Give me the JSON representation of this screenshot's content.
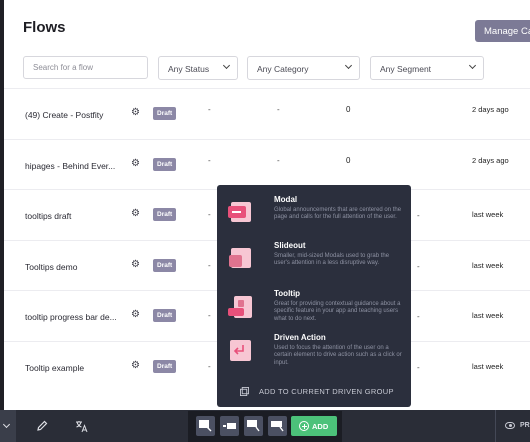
{
  "page": {
    "title": "Flows",
    "manage_button": "Manage Cate"
  },
  "filters": {
    "search_placeholder": "Search for a flow",
    "status": "Any Status",
    "category": "Any Category",
    "segment": "Any Segment"
  },
  "rows": [
    {
      "name": "(49) Create - Postfity",
      "badge": "Draft",
      "c1": "-",
      "c2": "-",
      "c3": "0",
      "c4": "",
      "date": "2 days ago"
    },
    {
      "name": "hipages - Behind Ever...",
      "badge": "Draft",
      "c1": "-",
      "c2": "-",
      "c3": "0",
      "c4": "",
      "date": "2 days ago"
    },
    {
      "name": "tooltips draft",
      "badge": "Draft",
      "c1": "-",
      "c2": "",
      "c3": "",
      "c4": "-",
      "date": "last week"
    },
    {
      "name": "Tooltips demo",
      "badge": "Draft",
      "c1": "-",
      "c2": "",
      "c3": "",
      "c4": "-",
      "date": "last week"
    },
    {
      "name": "tooltip progress bar de...",
      "badge": "Draft",
      "c1": "-",
      "c2": "",
      "c3": "",
      "c4": "-",
      "date": "last week"
    },
    {
      "name": "Tooltip example",
      "badge": "Draft",
      "c1": "-",
      "c2": "",
      "c3": "",
      "c4": "-",
      "date": "last week"
    }
  ],
  "popup": {
    "options": [
      {
        "title": "Modal",
        "desc": "Global announcements that are centered on the page and calls for the full attention of the user.",
        "icon": "modal-icon"
      },
      {
        "title": "Slideout",
        "desc": "Smaller, mid-sized Modals used to grab the user's attention in a less disruptive way.",
        "icon": "slideout-icon"
      },
      {
        "title": "Tooltip",
        "desc": "Great for providing contextual guidance about a specific feature in your app and teaching users what to do next.",
        "icon": "tooltip-icon"
      },
      {
        "title": "Driven Action",
        "desc": "Used to focus the attention of the user on a certain element to drive action such as a click or input.",
        "icon": "driven-action-icon"
      }
    ],
    "add_group_label": "ADD TO CURRENT DRIVEN GROUP"
  },
  "bottom_bar": {
    "add_label": "ADD",
    "preview_label": "PR"
  },
  "colors": {
    "accent_purple": "#7c7a96",
    "badge": "#8c88a6",
    "popup_bg": "#2b2f3d",
    "icon_pink": "#f3a7bd",
    "add_green": "#4cc27a"
  }
}
